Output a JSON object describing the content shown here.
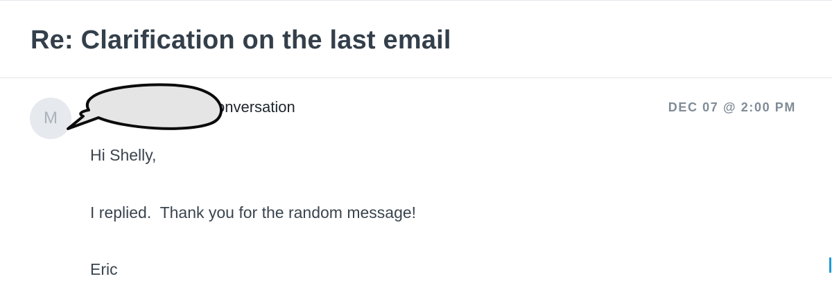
{
  "email": {
    "subject": "Re: Clarification on the last email",
    "avatar_initial": "M",
    "sender_visible_text": "onversation",
    "timestamp": "DEC 07 @ 2:00 PM",
    "body": {
      "greeting": "Hi Shelly,",
      "message": "I replied.  Thank you for the random message!",
      "signature": "Eric"
    }
  },
  "colors": {
    "subject": "#333f4a",
    "timestamp": "#7f8b97",
    "avatar_bg": "#e6e9ed",
    "redaction_fill": "#e5e5e5",
    "divider": "#dfe3e7",
    "edge_accent": "#1d9bd8"
  }
}
